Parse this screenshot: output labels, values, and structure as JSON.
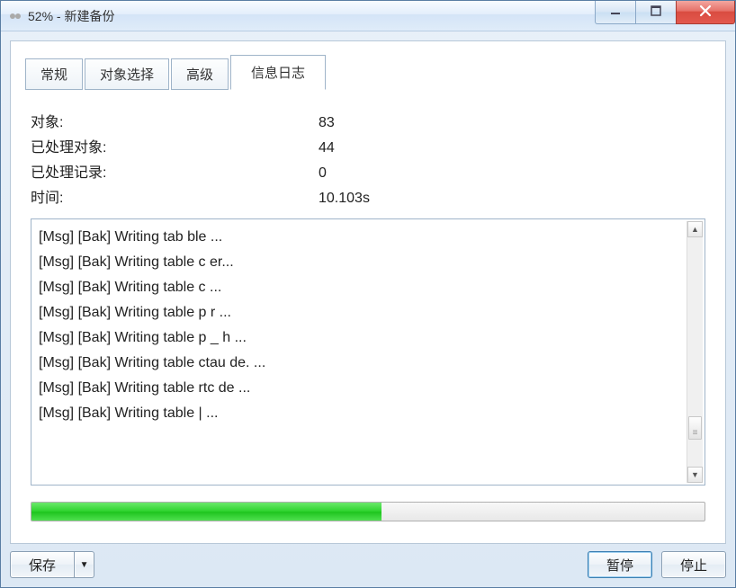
{
  "window": {
    "title": "52% - 新建备份"
  },
  "tabs": {
    "general": "常规",
    "object_select": "对象选择",
    "advanced": "高级",
    "info_log": "信息日志"
  },
  "stats": {
    "objects_label": "对象:",
    "objects_value": "83",
    "processed_objects_label": "已处理对象:",
    "processed_objects_value": "44",
    "processed_records_label": "已处理记录:",
    "processed_records_value": "0",
    "time_label": "时间:",
    "time_value": "10.103s"
  },
  "log_lines": [
    "[Msg] [Bak] Writing tab          ble         ...",
    "[Msg] [Bak] Writing table c                  er...",
    "[Msg] [Bak] Writing table c                  ...",
    "[Msg] [Bak] Writing table p             r  ...",
    "[Msg] [Bak] Writing table p        _     h     ...",
    "[Msg] [Bak] Writing table     ctau     de.  ...",
    "[Msg] [Bak] Writing table      rtc         de   ...",
    "[Msg] [Bak] Writing table |                                        ..."
  ],
  "progress_percent": 52,
  "buttons": {
    "save": "保存",
    "pause": "暂停",
    "stop": "停止"
  }
}
